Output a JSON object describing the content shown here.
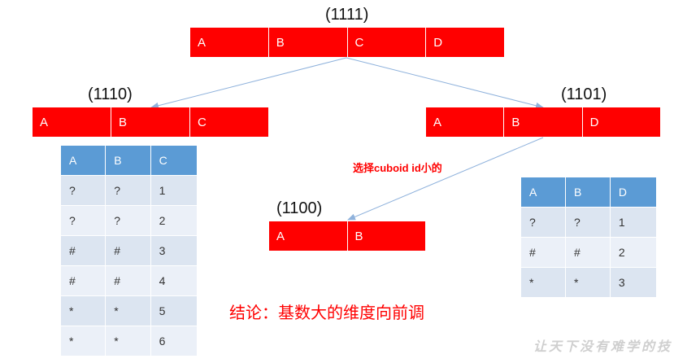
{
  "nodes": {
    "n1111": {
      "label": "(1111)",
      "cells": [
        "A",
        "B",
        "C",
        "D"
      ]
    },
    "n1110": {
      "label": "(1110)",
      "cells": [
        "A",
        "B",
        "C"
      ]
    },
    "n1101": {
      "label": "(1101)",
      "cells": [
        "A",
        "B",
        "D"
      ]
    },
    "n1100": {
      "label": "(1100)",
      "cells": [
        "A",
        "B"
      ]
    }
  },
  "left_table": {
    "headers": [
      "A",
      "B",
      "C"
    ],
    "rows": [
      [
        "?",
        "?",
        "1"
      ],
      [
        "?",
        "?",
        "2"
      ],
      [
        "#",
        "#",
        "3"
      ],
      [
        "#",
        "#",
        "4"
      ],
      [
        "*",
        "*",
        "5"
      ],
      [
        "*",
        "*",
        "6"
      ]
    ]
  },
  "right_table": {
    "headers": [
      "A",
      "B",
      "D"
    ],
    "rows": [
      [
        "?",
        "?",
        "1"
      ],
      [
        "#",
        "#",
        "2"
      ],
      [
        "*",
        "*",
        "3"
      ]
    ]
  },
  "annotation": "选择cuboid id小的",
  "conclusion": "结论：基数大的维度向前调",
  "watermark": "让天下没有难学的技",
  "colors": {
    "bar": "#ff0000",
    "header": "#5b9bd5",
    "row_dark": "#dce5f1",
    "row_light": "#ebf0f8",
    "arrow": "#8fb2dc"
  }
}
